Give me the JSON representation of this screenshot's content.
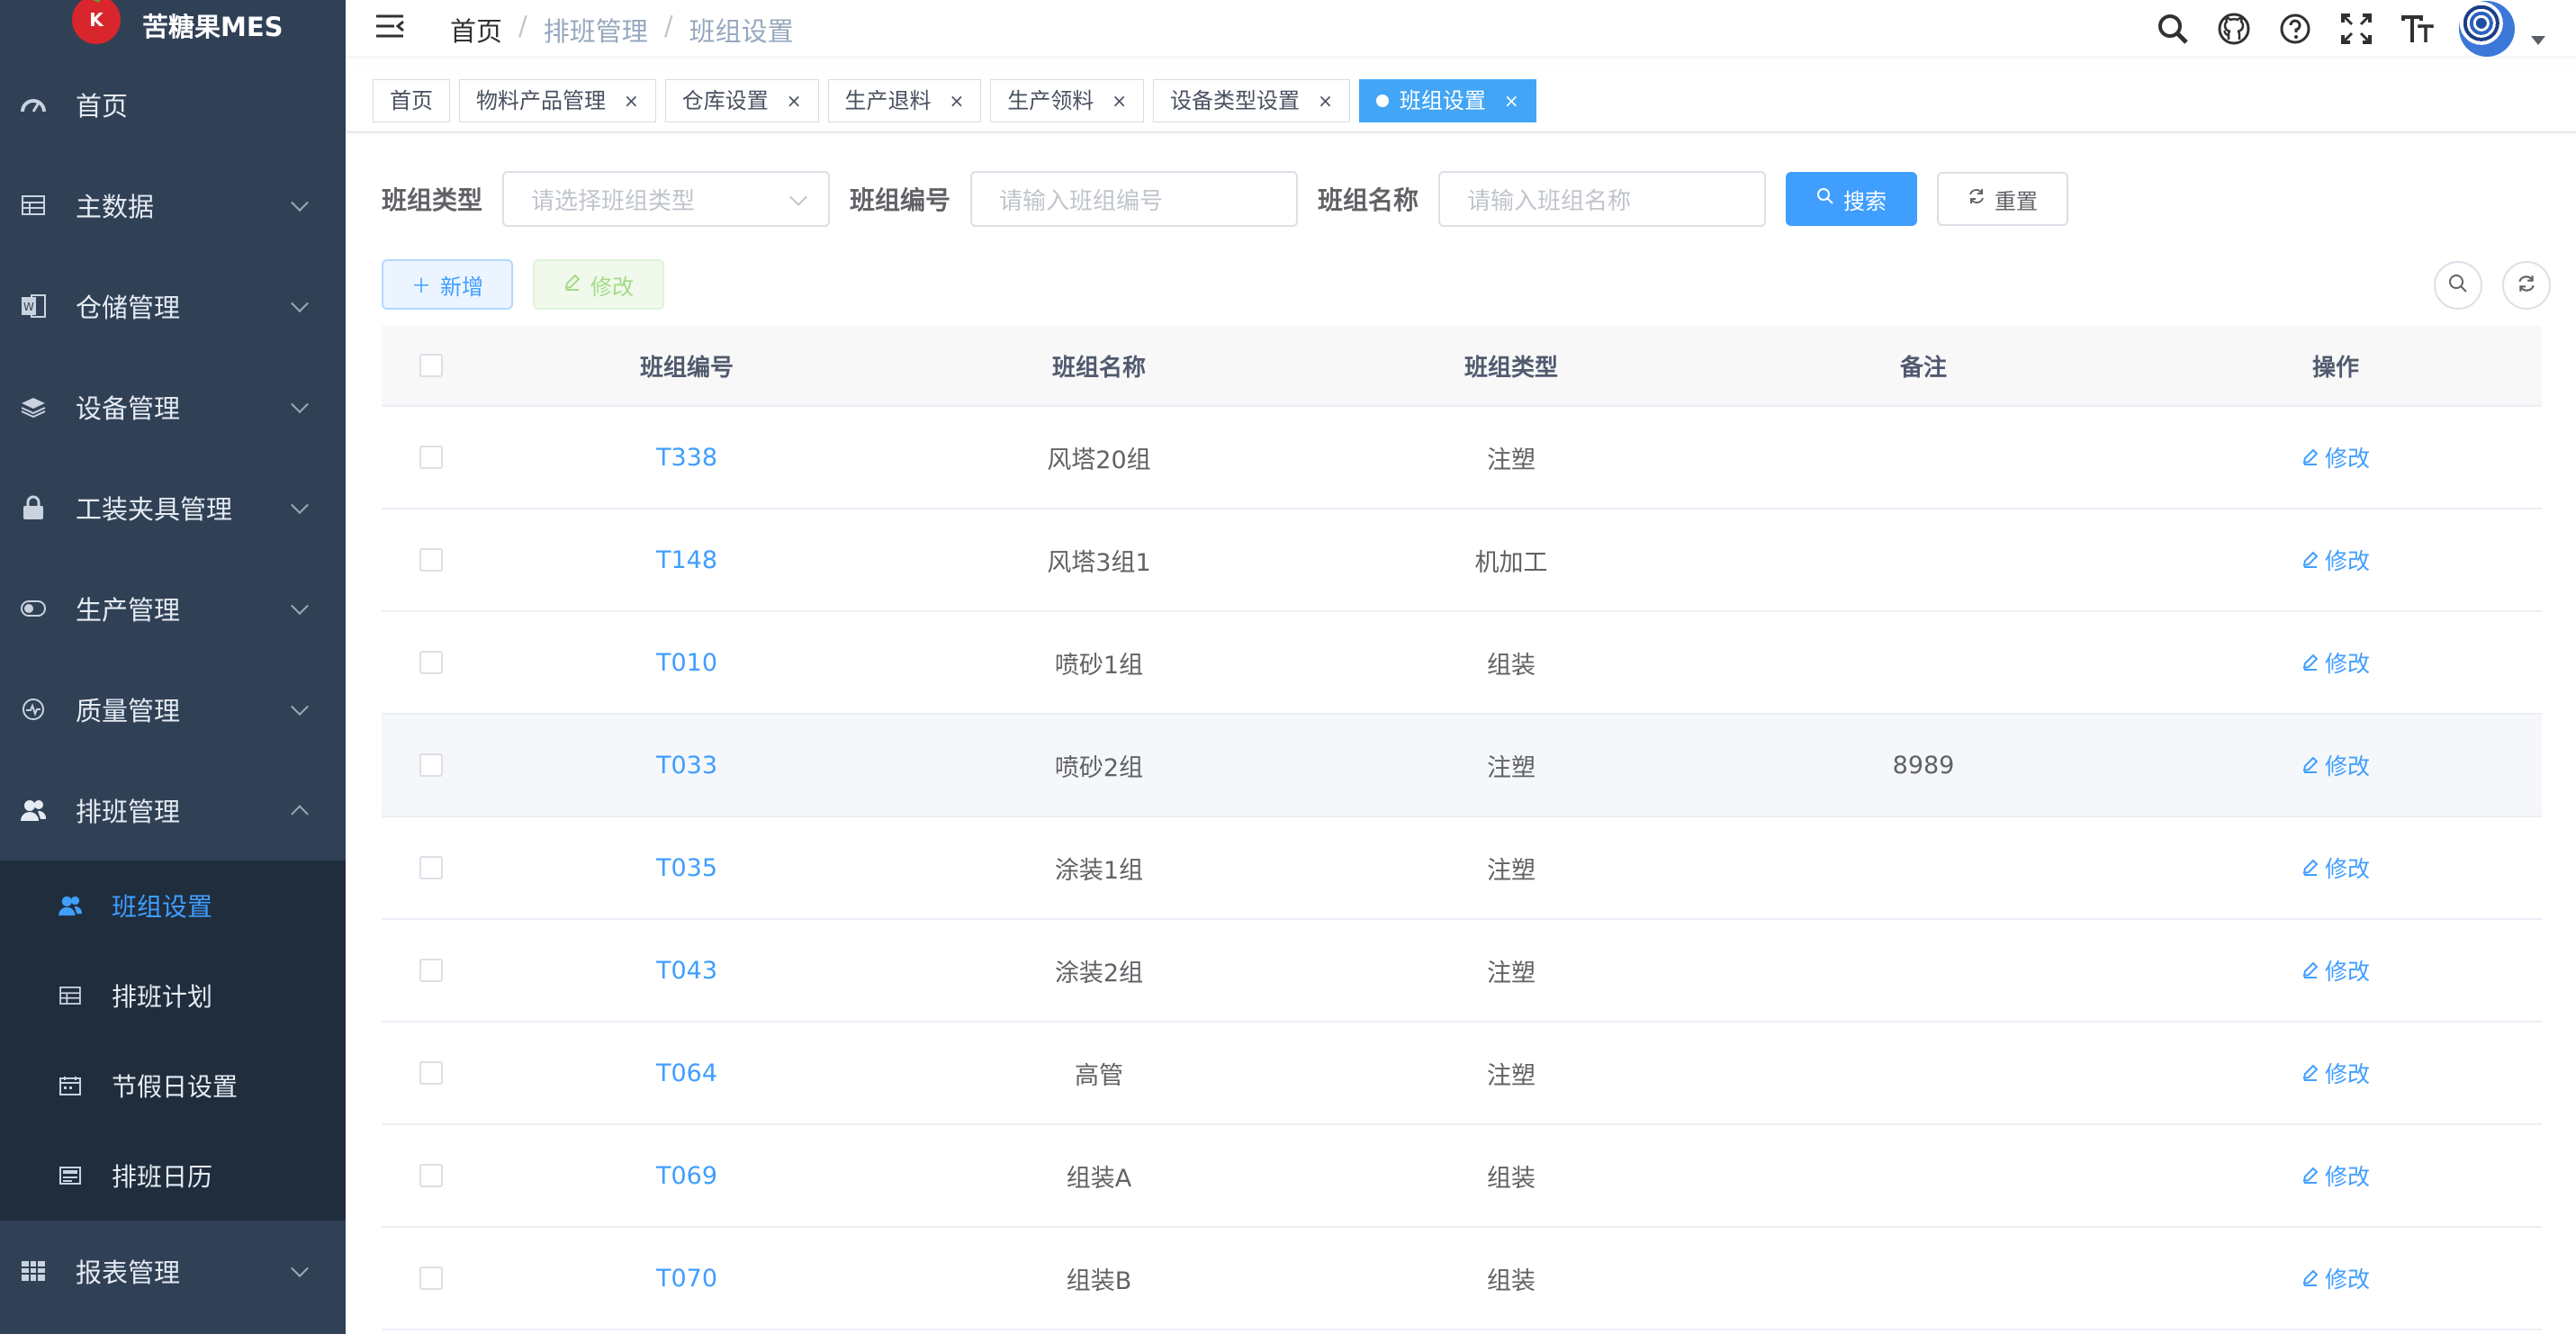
{
  "app": {
    "logo_text": "苦糖果MES"
  },
  "sidebar": {
    "items": [
      {
        "label": "首页",
        "icon": "dashboard-icon"
      },
      {
        "label": "主数据",
        "icon": "table-icon"
      },
      {
        "label": "仓储管理",
        "icon": "word-icon"
      },
      {
        "label": "设备管理",
        "icon": "layers-icon"
      },
      {
        "label": "工装夹具管理",
        "icon": "lock-icon"
      },
      {
        "label": "生产管理",
        "icon": "toggle-icon"
      },
      {
        "label": "质量管理",
        "icon": "monitor-icon"
      },
      {
        "label": "排班管理",
        "icon": "peoples-icon"
      },
      {
        "label": "报表管理",
        "icon": "grid-icon"
      }
    ],
    "sub_items": [
      {
        "label": "班组设置",
        "icon": "peoples-icon"
      },
      {
        "label": "排班计划",
        "icon": "table-icon"
      },
      {
        "label": "节假日设置",
        "icon": "calendar-icon"
      },
      {
        "label": "排班日历",
        "icon": "date-icon"
      }
    ]
  },
  "navbar": {
    "breadcrumb": [
      "首页",
      "排班管理",
      "班组设置"
    ]
  },
  "tags": [
    {
      "label": "首页"
    },
    {
      "label": "物料产品管理"
    },
    {
      "label": "仓库设置"
    },
    {
      "label": "生产退料"
    },
    {
      "label": "生产领料"
    },
    {
      "label": "设备类型设置"
    },
    {
      "label": "班组设置"
    }
  ],
  "search": {
    "type_label": "班组类型",
    "type_placeholder": "请选择班组类型",
    "code_label": "班组编号",
    "code_placeholder": "请输入班组编号",
    "name_label": "班组名称",
    "name_placeholder": "请输入班组名称",
    "search_button": "搜索",
    "reset_button": "重置"
  },
  "toolbar": {
    "add_label": "新增",
    "edit_label": "修改"
  },
  "table": {
    "headers": [
      "班组编号",
      "班组名称",
      "班组类型",
      "备注",
      "操作"
    ],
    "action_label": "修改",
    "rows": [
      {
        "code": "T338",
        "name": "风塔20组",
        "type": "注塑",
        "remark": ""
      },
      {
        "code": "T148",
        "name": "风塔3组1",
        "type": "机加工",
        "remark": ""
      },
      {
        "code": "T010",
        "name": "喷砂1组",
        "type": "组装",
        "remark": ""
      },
      {
        "code": "T033",
        "name": "喷砂2组",
        "type": "注塑",
        "remark": "8989"
      },
      {
        "code": "T035",
        "name": "涂装1组",
        "type": "注塑",
        "remark": ""
      },
      {
        "code": "T043",
        "name": "涂装2组",
        "type": "注塑",
        "remark": ""
      },
      {
        "code": "T064",
        "name": "高管",
        "type": "注塑",
        "remark": ""
      },
      {
        "code": "T069",
        "name": "组装A",
        "type": "组装",
        "remark": ""
      },
      {
        "code": "T070",
        "name": "组装B",
        "type": "组装",
        "remark": ""
      }
    ]
  },
  "colors": {
    "sidebar_bg": "#304156",
    "submenu_bg": "#1f2d3d",
    "primary": "#409eff",
    "active_tag": "#42a5f5"
  }
}
